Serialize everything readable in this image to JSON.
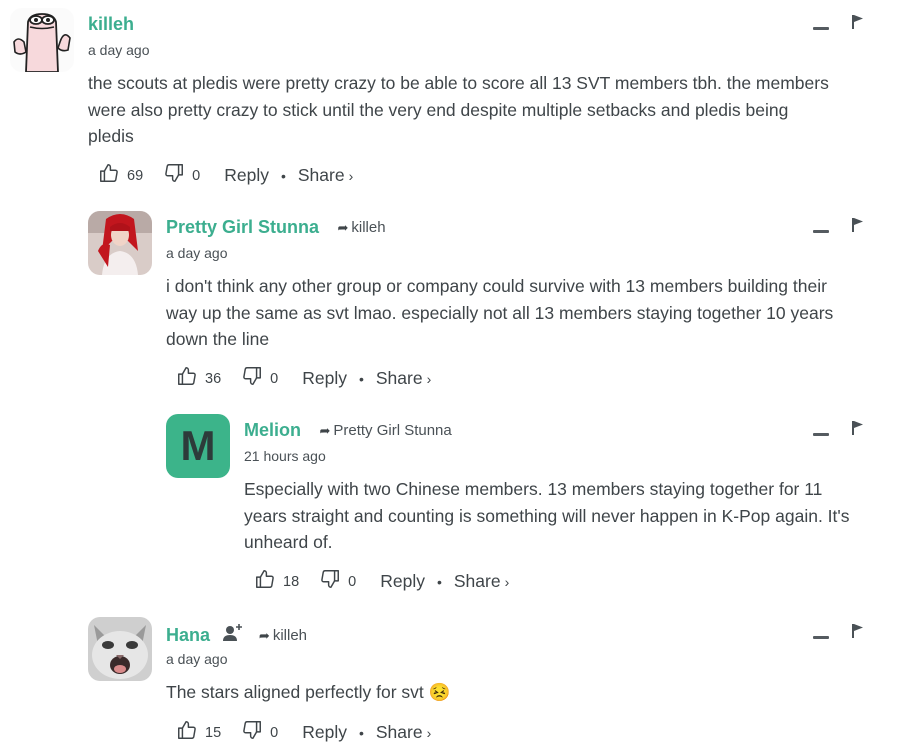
{
  "comments": [
    {
      "author": "killeh",
      "reply_to": "",
      "time": "a day ago",
      "text_lines": [
        "the scouts at pledis were pretty crazy to be able to score all 13 SVT members tbh. the members",
        "were also pretty crazy to stick until the very end despite multiple setbacks and pledis being",
        "pledis"
      ],
      "likes": "69",
      "dislikes": "0",
      "avatar": "cartoon-thumbs-up"
    },
    {
      "author": "Pretty Girl Stunna",
      "reply_to": "killeh",
      "time": "a day ago",
      "text_lines": [
        "i don't think any other group or company could survive with 13 members building their",
        "way up the same as svt lmao. especially not all 13 members staying together 10 years",
        "down the line"
      ],
      "likes": "36",
      "dislikes": "0",
      "avatar": "photo-red-hair"
    },
    {
      "author": "Melion",
      "reply_to": "Pretty Girl Stunna",
      "time": "21 hours ago",
      "text_lines": [
        "Especially with two Chinese members. 13 members staying together for 11",
        "years straight and counting is something will never happen in K-Pop again. It's",
        "unheard of."
      ],
      "likes": "18",
      "dislikes": "0",
      "avatar_letter": "M",
      "avatar_color": "#3cb48a"
    },
    {
      "author": "Hana",
      "reply_to": "killeh",
      "time": "a day ago",
      "text_lines": [
        "The stars aligned perfectly for svt 😣"
      ],
      "likes": "15",
      "dislikes": "0",
      "avatar": "crying-cat"
    }
  ],
  "labels": {
    "reply": "Reply",
    "share": "Share",
    "chevron": "›",
    "bullet": "•",
    "reply_arrow": "➦"
  },
  "colors": {
    "author": "#3cae8f",
    "text": "#3f4549"
  }
}
